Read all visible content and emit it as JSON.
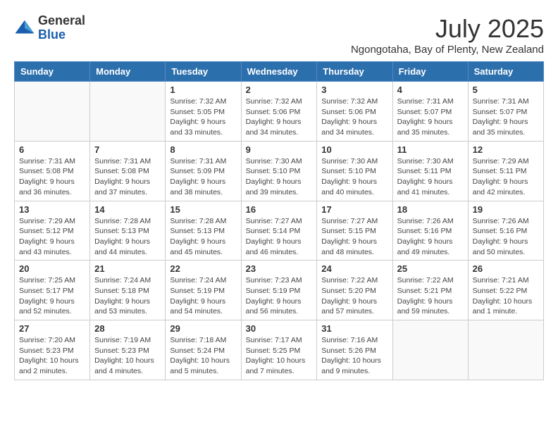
{
  "logo": {
    "general": "General",
    "blue": "Blue"
  },
  "title": {
    "month_year": "July 2025",
    "location": "Ngongotaha, Bay of Plenty, New Zealand"
  },
  "weekdays": [
    "Sunday",
    "Monday",
    "Tuesday",
    "Wednesday",
    "Thursday",
    "Friday",
    "Saturday"
  ],
  "weeks": [
    [
      {
        "day": "",
        "info": ""
      },
      {
        "day": "",
        "info": ""
      },
      {
        "day": "1",
        "info": "Sunrise: 7:32 AM\nSunset: 5:05 PM\nDaylight: 9 hours and 33 minutes."
      },
      {
        "day": "2",
        "info": "Sunrise: 7:32 AM\nSunset: 5:06 PM\nDaylight: 9 hours and 34 minutes."
      },
      {
        "day": "3",
        "info": "Sunrise: 7:32 AM\nSunset: 5:06 PM\nDaylight: 9 hours and 34 minutes."
      },
      {
        "day": "4",
        "info": "Sunrise: 7:31 AM\nSunset: 5:07 PM\nDaylight: 9 hours and 35 minutes."
      },
      {
        "day": "5",
        "info": "Sunrise: 7:31 AM\nSunset: 5:07 PM\nDaylight: 9 hours and 35 minutes."
      }
    ],
    [
      {
        "day": "6",
        "info": "Sunrise: 7:31 AM\nSunset: 5:08 PM\nDaylight: 9 hours and 36 minutes."
      },
      {
        "day": "7",
        "info": "Sunrise: 7:31 AM\nSunset: 5:08 PM\nDaylight: 9 hours and 37 minutes."
      },
      {
        "day": "8",
        "info": "Sunrise: 7:31 AM\nSunset: 5:09 PM\nDaylight: 9 hours and 38 minutes."
      },
      {
        "day": "9",
        "info": "Sunrise: 7:30 AM\nSunset: 5:10 PM\nDaylight: 9 hours and 39 minutes."
      },
      {
        "day": "10",
        "info": "Sunrise: 7:30 AM\nSunset: 5:10 PM\nDaylight: 9 hours and 40 minutes."
      },
      {
        "day": "11",
        "info": "Sunrise: 7:30 AM\nSunset: 5:11 PM\nDaylight: 9 hours and 41 minutes."
      },
      {
        "day": "12",
        "info": "Sunrise: 7:29 AM\nSunset: 5:11 PM\nDaylight: 9 hours and 42 minutes."
      }
    ],
    [
      {
        "day": "13",
        "info": "Sunrise: 7:29 AM\nSunset: 5:12 PM\nDaylight: 9 hours and 43 minutes."
      },
      {
        "day": "14",
        "info": "Sunrise: 7:28 AM\nSunset: 5:13 PM\nDaylight: 9 hours and 44 minutes."
      },
      {
        "day": "15",
        "info": "Sunrise: 7:28 AM\nSunset: 5:13 PM\nDaylight: 9 hours and 45 minutes."
      },
      {
        "day": "16",
        "info": "Sunrise: 7:27 AM\nSunset: 5:14 PM\nDaylight: 9 hours and 46 minutes."
      },
      {
        "day": "17",
        "info": "Sunrise: 7:27 AM\nSunset: 5:15 PM\nDaylight: 9 hours and 48 minutes."
      },
      {
        "day": "18",
        "info": "Sunrise: 7:26 AM\nSunset: 5:16 PM\nDaylight: 9 hours and 49 minutes."
      },
      {
        "day": "19",
        "info": "Sunrise: 7:26 AM\nSunset: 5:16 PM\nDaylight: 9 hours and 50 minutes."
      }
    ],
    [
      {
        "day": "20",
        "info": "Sunrise: 7:25 AM\nSunset: 5:17 PM\nDaylight: 9 hours and 52 minutes."
      },
      {
        "day": "21",
        "info": "Sunrise: 7:24 AM\nSunset: 5:18 PM\nDaylight: 9 hours and 53 minutes."
      },
      {
        "day": "22",
        "info": "Sunrise: 7:24 AM\nSunset: 5:19 PM\nDaylight: 9 hours and 54 minutes."
      },
      {
        "day": "23",
        "info": "Sunrise: 7:23 AM\nSunset: 5:19 PM\nDaylight: 9 hours and 56 minutes."
      },
      {
        "day": "24",
        "info": "Sunrise: 7:22 AM\nSunset: 5:20 PM\nDaylight: 9 hours and 57 minutes."
      },
      {
        "day": "25",
        "info": "Sunrise: 7:22 AM\nSunset: 5:21 PM\nDaylight: 9 hours and 59 minutes."
      },
      {
        "day": "26",
        "info": "Sunrise: 7:21 AM\nSunset: 5:22 PM\nDaylight: 10 hours and 1 minute."
      }
    ],
    [
      {
        "day": "27",
        "info": "Sunrise: 7:20 AM\nSunset: 5:23 PM\nDaylight: 10 hours and 2 minutes."
      },
      {
        "day": "28",
        "info": "Sunrise: 7:19 AM\nSunset: 5:23 PM\nDaylight: 10 hours and 4 minutes."
      },
      {
        "day": "29",
        "info": "Sunrise: 7:18 AM\nSunset: 5:24 PM\nDaylight: 10 hours and 5 minutes."
      },
      {
        "day": "30",
        "info": "Sunrise: 7:17 AM\nSunset: 5:25 PM\nDaylight: 10 hours and 7 minutes."
      },
      {
        "day": "31",
        "info": "Sunrise: 7:16 AM\nSunset: 5:26 PM\nDaylight: 10 hours and 9 minutes."
      },
      {
        "day": "",
        "info": ""
      },
      {
        "day": "",
        "info": ""
      }
    ]
  ]
}
